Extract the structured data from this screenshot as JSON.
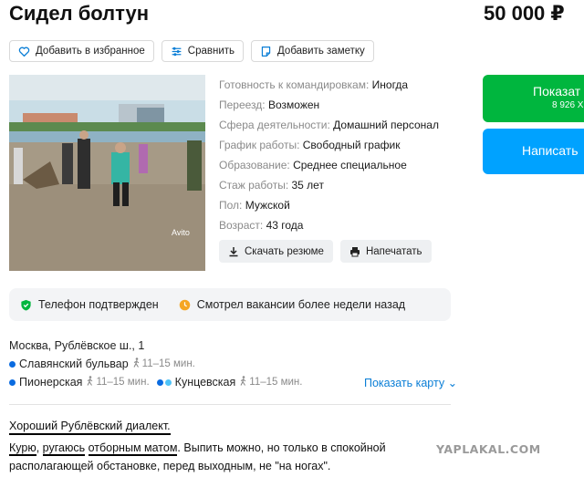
{
  "listing": {
    "title": "Сидел болтун",
    "price": "50 000 ₽"
  },
  "actions": {
    "favorite": {
      "label": "Добавить в избранное",
      "icon": "heart-icon"
    },
    "compare": {
      "label": "Сравнить",
      "icon": "compare-icon"
    },
    "note": {
      "label": "Добавить заметку",
      "icon": "note-icon"
    }
  },
  "photo": {
    "watermark": "Avito"
  },
  "details": [
    {
      "key": "Готовность к командировкам:",
      "value": "Иногда"
    },
    {
      "key": "Переезд:",
      "value": "Возможен"
    },
    {
      "key": "Сфера деятельности:",
      "value": "Домашний персонал"
    },
    {
      "key": "График работы:",
      "value": "Свободный график"
    },
    {
      "key": "Образование:",
      "value": "Среднее специальное"
    },
    {
      "key": "Стаж работы:",
      "value": "35 лет"
    },
    {
      "key": "Пол:",
      "value": "Мужской"
    },
    {
      "key": "Возраст:",
      "value": "43 года"
    }
  ],
  "doc_actions": {
    "download": {
      "label": "Скачать резюме",
      "icon": "download-icon"
    },
    "print": {
      "label": "Напечатать",
      "icon": "printer-icon"
    }
  },
  "cta": {
    "show_phone": "Показат",
    "phone_partial": "8 926 X",
    "write": "Написать"
  },
  "badges": {
    "phone_verified": "Телефон подтвержден",
    "viewed_vacancies": "Смотрел вакансии более недели назад"
  },
  "location": {
    "address": "Москва, Рублёвское ш., 1",
    "metro": [
      {
        "name": "Славянский бульвар",
        "time": "11–15 мин.",
        "color": "#0a6be0"
      },
      {
        "name": "Пионерская",
        "time": "11–15 мин.",
        "color": "#0a6be0"
      },
      {
        "name": "Кунцевская",
        "time": "11–15 мин.",
        "color": "#0a6be0"
      }
    ],
    "show_map": "Показать карту"
  },
  "description": {
    "line1": "Хороший Рублёвский диалект.",
    "line2_part1": "Курю",
    "line2_part2": ", ",
    "line2_part3": "ругаюсь",
    "line2_part4": " ",
    "line2_part5": "отборным матом",
    "line2_rest": ". Выпить можно, но только в спокойной располагающей обстановке, перед выходным, не \"на ногах\"."
  },
  "site_watermark": "YAPLAKAL.COM",
  "colors": {
    "green": "#00b63e",
    "blue": "#00a2ff",
    "link": "#0a7ed6",
    "shield": "#00b63e",
    "clock": "#f5a623"
  }
}
